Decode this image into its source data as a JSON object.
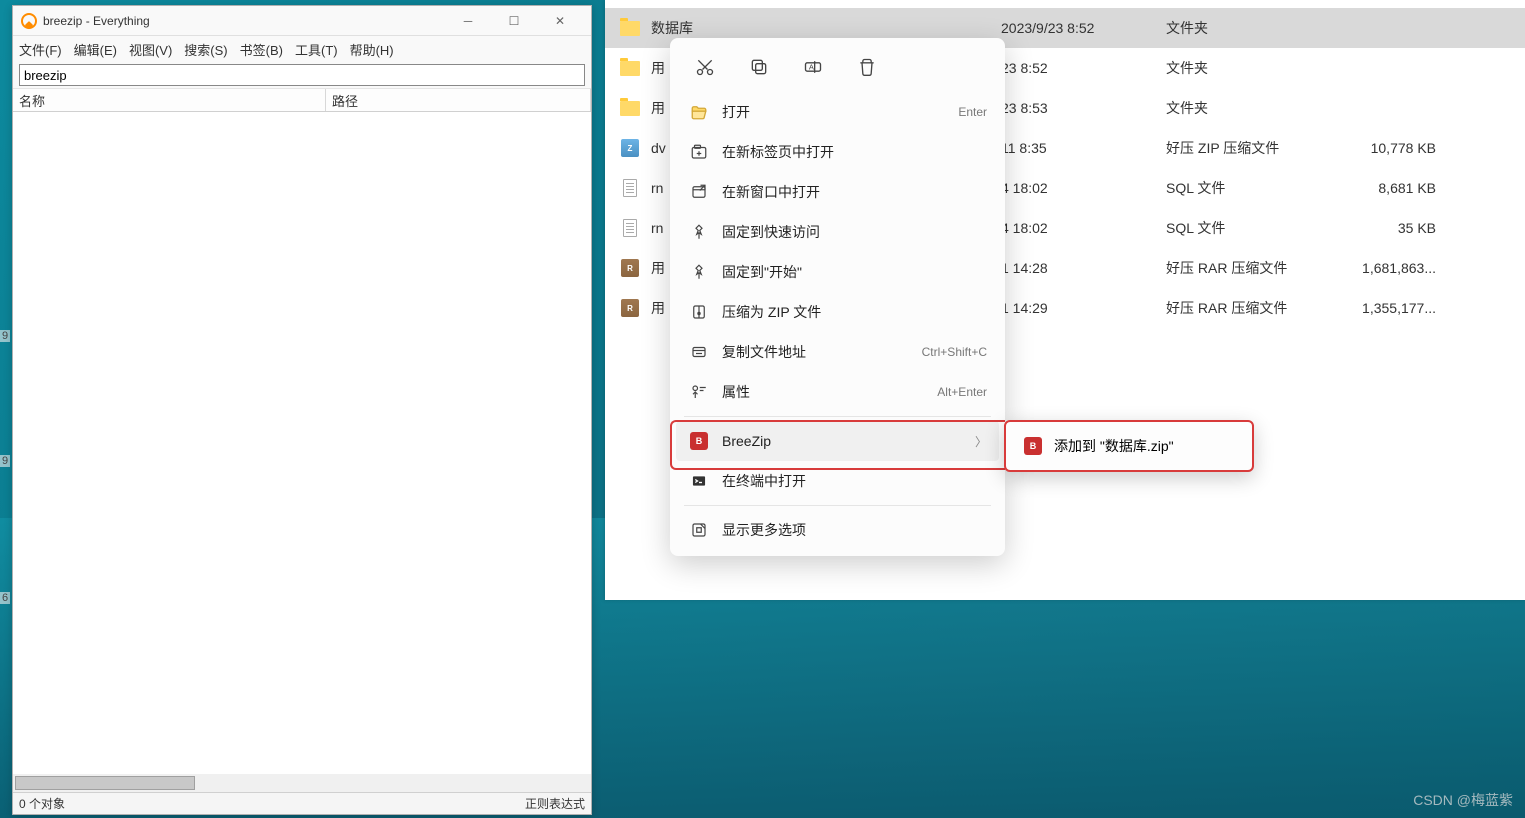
{
  "everything": {
    "title": "breezip - Everything",
    "menu": [
      "文件(F)",
      "编辑(E)",
      "视图(V)",
      "搜索(S)",
      "书签(B)",
      "工具(T)",
      "帮助(H)"
    ],
    "search_value": "breezip",
    "columns": {
      "name": "名称",
      "path": "路径"
    },
    "status_left": "0 个对象",
    "status_right": "正则表达式"
  },
  "explorer": {
    "rows": [
      {
        "icon": "folder",
        "name": "数据库",
        "date": "2023/9/23 8:52",
        "type": "文件夹",
        "size": "",
        "selected": true
      },
      {
        "icon": "folder",
        "name": "用",
        "date": "23 8:52",
        "type": "文件夹",
        "size": ""
      },
      {
        "icon": "folder",
        "name": "用",
        "date": "23 8:53",
        "type": "文件夹",
        "size": ""
      },
      {
        "icon": "zip",
        "name": "dv",
        "date": "11 8:35",
        "type": "好压 ZIP 压缩文件",
        "size": "10,778 KB"
      },
      {
        "icon": "sql",
        "name": "rn",
        "date": "4 18:02",
        "type": "SQL 文件",
        "size": "8,681 KB"
      },
      {
        "icon": "sql",
        "name": "rn",
        "date": "4 18:02",
        "type": "SQL 文件",
        "size": "35 KB"
      },
      {
        "icon": "rar",
        "name": "用",
        "date": "1 14:28",
        "type": "好压 RAR 压缩文件",
        "size": "1,681,863..."
      },
      {
        "icon": "rar",
        "name": "用",
        "date": "1 14:29",
        "type": "好压 RAR 压缩文件",
        "size": "1,355,177..."
      }
    ]
  },
  "context_menu": {
    "top_icons": [
      "cut-icon",
      "copy-icon",
      "rename-icon",
      "delete-icon"
    ],
    "items": [
      {
        "icon": "open-icon",
        "label": "打开",
        "shortcut": "Enter"
      },
      {
        "icon": "new-tab-icon",
        "label": "在新标签页中打开",
        "shortcut": ""
      },
      {
        "icon": "new-window-icon",
        "label": "在新窗口中打开",
        "shortcut": ""
      },
      {
        "icon": "pin-icon",
        "label": "固定到快速访问",
        "shortcut": ""
      },
      {
        "icon": "pin-start-icon",
        "label": "固定到\"开始\"",
        "shortcut": ""
      },
      {
        "icon": "compress-icon",
        "label": "压缩为 ZIP 文件",
        "shortcut": ""
      },
      {
        "icon": "copy-path-icon",
        "label": "复制文件地址",
        "shortcut": "Ctrl+Shift+C"
      },
      {
        "icon": "properties-icon",
        "label": "属性",
        "shortcut": "Alt+Enter"
      },
      {
        "sep": true
      },
      {
        "icon": "breezip-icon",
        "label": "BreeZip",
        "shortcut": "",
        "submenu": true,
        "hover": true
      },
      {
        "icon": "terminal-icon",
        "label": "在终端中打开",
        "shortcut": ""
      },
      {
        "sep": true
      },
      {
        "icon": "more-icon",
        "label": "显示更多选项",
        "shortcut": ""
      }
    ]
  },
  "submenu": {
    "item": "添加到 \"数据库.zip\""
  },
  "watermark": "CSDN @梅蓝紫",
  "edge_numbers": [
    "9",
    "9",
    "6"
  ]
}
